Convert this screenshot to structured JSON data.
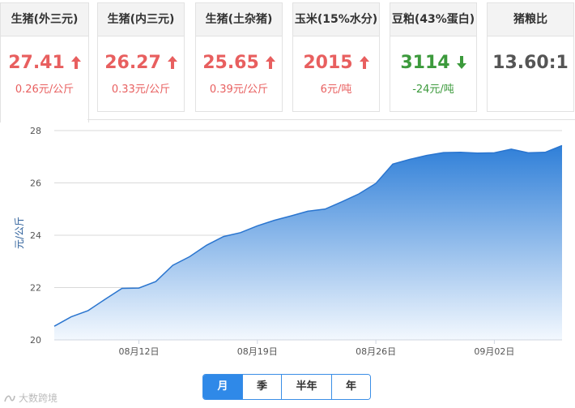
{
  "cards": [
    {
      "title": "生猪(外三元)",
      "price": "27.41",
      "trend": "up",
      "change": "0.26元/公斤"
    },
    {
      "title": "生猪(内三元)",
      "price": "26.27",
      "trend": "up",
      "change": "0.33元/公斤"
    },
    {
      "title": "生猪(土杂猪)",
      "price": "25.65",
      "trend": "up",
      "change": "0.39元/公斤"
    },
    {
      "title": "玉米(15%水分)",
      "price": "2015",
      "trend": "up",
      "change": "6元/吨"
    },
    {
      "title": "豆粕(43%蛋白)",
      "price": "3114",
      "trend": "down",
      "change": "-24元/吨"
    },
    {
      "title": "猪粮比",
      "price": "13.60:1",
      "trend": "none",
      "change": ""
    }
  ],
  "colors": {
    "up": "#e85f5f",
    "down": "#3c9a3c",
    "area_top": "#2f7fd8",
    "area_bottom": "#f3f8fe",
    "accent": "#2f89e8"
  },
  "chart_data": {
    "type": "area",
    "ylabel": "元/公斤",
    "ylim": [
      20,
      28
    ],
    "yticks": [
      20,
      22,
      24,
      26,
      28
    ],
    "grid": true,
    "x": [
      "08-07",
      "08-08",
      "08-09",
      "08-10",
      "08-11",
      "08-12",
      "08-13",
      "08-14",
      "08-15",
      "08-16",
      "08-17",
      "08-18",
      "08-19",
      "08-20",
      "08-21",
      "08-22",
      "08-23",
      "08-24",
      "08-25",
      "08-26",
      "08-27",
      "08-28",
      "08-29",
      "08-30",
      "08-31",
      "09-01",
      "09-02",
      "09-03",
      "09-04",
      "09-05",
      "09-06"
    ],
    "xtick_labels": [
      {
        "at": "08-12",
        "label": "08月12日"
      },
      {
        "at": "08-19",
        "label": "08月19日"
      },
      {
        "at": "08-26",
        "label": "08月26日"
      },
      {
        "at": "09-02",
        "label": "09月02日"
      }
    ],
    "values": [
      20.52,
      20.88,
      21.12,
      21.55,
      21.97,
      21.98,
      22.23,
      22.85,
      23.18,
      23.62,
      23.95,
      24.1,
      24.36,
      24.57,
      24.74,
      24.92,
      25.0,
      25.28,
      25.58,
      25.98,
      26.72,
      26.9,
      27.05,
      27.16,
      27.17,
      27.14,
      27.15,
      27.29,
      27.15,
      27.17,
      27.43
    ]
  },
  "ranges": [
    "月",
    "季",
    "半年",
    "年"
  ],
  "selected_range": "月",
  "watermark": "大数跨境"
}
